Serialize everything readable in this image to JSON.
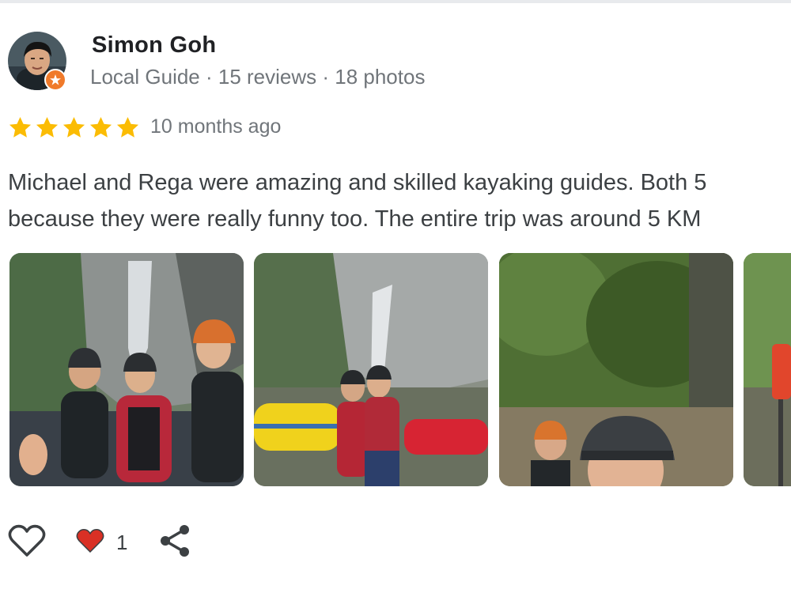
{
  "reviewer": {
    "name": "Simon Goh",
    "meta": "Local Guide · 15 reviews · 18 photos",
    "avatar_icon": "avatar-photo",
    "badge_icon": "local-guide-badge-icon"
  },
  "review": {
    "rating": 5,
    "rating_max": 5,
    "date": "10 months ago",
    "text_lines": [
      "Michael and Rega were amazing and skilled kayaking guides. Both 5",
      "because they were really funny too. The entire trip was around 5 KM"
    ]
  },
  "photos": [
    {
      "subject": "group-selfie-waterfall"
    },
    {
      "subject": "rafts-at-waterfall"
    },
    {
      "subject": "jungle-river-selfie"
    },
    {
      "subject": "paddle-partial"
    }
  ],
  "actions": {
    "like_icon": "heart-outline-icon",
    "reaction_icon": "heart-filled-icon",
    "like_count": "1",
    "share_icon": "share-icon"
  },
  "colors": {
    "star": "#fbbc04",
    "heart": "#d93025",
    "badge": "#f07a2a",
    "secondary_text": "#70757a"
  }
}
